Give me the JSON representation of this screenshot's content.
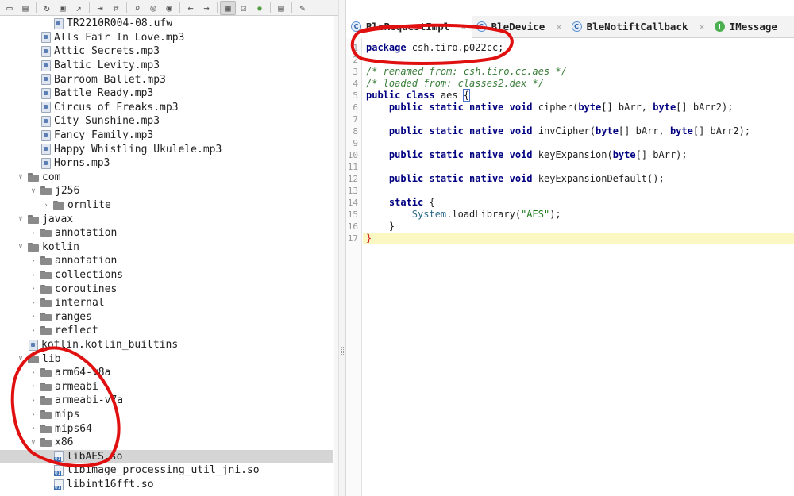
{
  "toolbar": {
    "icons": [
      "folder-open-icon",
      "save-all-icon",
      "refresh-icon",
      "save-icon",
      "export-icon",
      "expand-icon",
      "sync-icon",
      "search-icon",
      "find-class-icon",
      "find-usage-icon",
      "back-icon",
      "forward-icon",
      "flatten-icon",
      "decompile-icon",
      "debug-icon",
      "log-icon",
      "settings-icon"
    ]
  },
  "tree": {
    "rows": [
      {
        "label": "TR2210R004-08.ufw",
        "indent": 4,
        "type": "file"
      },
      {
        "label": "Alls Fair In Love.mp3",
        "indent": 3,
        "type": "file"
      },
      {
        "label": "Attic Secrets.mp3",
        "indent": 3,
        "type": "file"
      },
      {
        "label": "Baltic Levity.mp3",
        "indent": 3,
        "type": "file"
      },
      {
        "label": "Barroom Ballet.mp3",
        "indent": 3,
        "type": "file"
      },
      {
        "label": "Battle Ready.mp3",
        "indent": 3,
        "type": "file"
      },
      {
        "label": "Circus of Freaks.mp3",
        "indent": 3,
        "type": "file"
      },
      {
        "label": "City Sunshine.mp3",
        "indent": 3,
        "type": "file"
      },
      {
        "label": "Fancy Family.mp3",
        "indent": 3,
        "type": "file"
      },
      {
        "label": "Happy Whistling Ukulele.mp3",
        "indent": 3,
        "type": "file"
      },
      {
        "label": "Horns.mp3",
        "indent": 3,
        "type": "file"
      },
      {
        "label": "com",
        "indent": 1,
        "type": "folder",
        "open": true
      },
      {
        "label": "j256",
        "indent": 2,
        "type": "folder",
        "open": true
      },
      {
        "label": "ormlite",
        "indent": 3,
        "type": "folder",
        "open": false
      },
      {
        "label": "javax",
        "indent": 1,
        "type": "folder",
        "open": true
      },
      {
        "label": "annotation",
        "indent": 2,
        "type": "folder",
        "open": false
      },
      {
        "label": "kotlin",
        "indent": 1,
        "type": "folder",
        "open": true
      },
      {
        "label": "annotation",
        "indent": 2,
        "type": "folder",
        "open": false
      },
      {
        "label": "collections",
        "indent": 2,
        "type": "folder",
        "open": false
      },
      {
        "label": "coroutines",
        "indent": 2,
        "type": "folder",
        "open": false
      },
      {
        "label": "internal",
        "indent": 2,
        "type": "folder",
        "open": false
      },
      {
        "label": "ranges",
        "indent": 2,
        "type": "folder",
        "open": false
      },
      {
        "label": "reflect",
        "indent": 2,
        "type": "folder",
        "open": false
      },
      {
        "label": "kotlin.kotlin_builtins",
        "indent": 2,
        "type": "file"
      },
      {
        "label": "lib",
        "indent": 1,
        "type": "folder",
        "open": true
      },
      {
        "label": "arm64-v8a",
        "indent": 2,
        "type": "folder",
        "open": false
      },
      {
        "label": "armeabi",
        "indent": 2,
        "type": "folder",
        "open": false
      },
      {
        "label": "armeabi-v7a",
        "indent": 2,
        "type": "folder",
        "open": false
      },
      {
        "label": "mips",
        "indent": 2,
        "type": "folder",
        "open": false
      },
      {
        "label": "mips64",
        "indent": 2,
        "type": "folder",
        "open": false
      },
      {
        "label": "x86",
        "indent": 2,
        "type": "folder",
        "open": true
      },
      {
        "label": "libAES.so",
        "indent": 4,
        "type": "so",
        "selected": true
      },
      {
        "label": "libimage_processing_util_jni.so",
        "indent": 4,
        "type": "so"
      },
      {
        "label": "libint16fft.so",
        "indent": 4,
        "type": "so"
      }
    ]
  },
  "tabs": [
    {
      "label": "BleRequestImpl",
      "icon": "C",
      "active": true
    },
    {
      "label": "BleDevice",
      "icon": "C"
    },
    {
      "label": "BleNotiftCallback",
      "icon": "C"
    },
    {
      "label": "IMessage",
      "icon": "I"
    }
  ],
  "editor": {
    "lines": [
      {
        "n": "1",
        "html": "<span class='kw'>package</span> csh.tiro.p022cc;"
      },
      {
        "n": "2",
        "html": ""
      },
      {
        "n": "3",
        "html": "<span class='cm'>/* renamed from: csh.tiro.cc.aes */</span>"
      },
      {
        "n": "4",
        "html": "<span class='cm'>/* loaded from: classes2.dex */</span>"
      },
      {
        "n": "5",
        "html": "<span class='kw'>public class</span> aes <span class='brace-box'>{</span>"
      },
      {
        "n": "6",
        "html": "    <span class='kw'>public static native void</span> cipher(<span class='kw'>byte</span>[] bArr, <span class='kw'>byte</span>[] bArr2);"
      },
      {
        "n": "7",
        "html": ""
      },
      {
        "n": "8",
        "html": "    <span class='kw'>public static native void</span> invCipher(<span class='kw'>byte</span>[] bArr, <span class='kw'>byte</span>[] bArr2);"
      },
      {
        "n": "9",
        "html": ""
      },
      {
        "n": "10",
        "html": "    <span class='kw'>public static native void</span> keyExpansion(<span class='kw'>byte</span>[] bArr);"
      },
      {
        "n": "11",
        "html": ""
      },
      {
        "n": "12",
        "html": "    <span class='kw'>public static native void</span> keyExpansionDefault();"
      },
      {
        "n": "13",
        "html": ""
      },
      {
        "n": "14",
        "html": "    <span class='kw'>static</span> {"
      },
      {
        "n": "15",
        "html": "        <span class='cls'>System</span>.loadLibrary(<span class='str'>\"AES\"</span>);"
      },
      {
        "n": "16",
        "html": "    }"
      },
      {
        "n": "17",
        "html": "<span class='brace-red'>}</span>"
      }
    ],
    "highlighted_line": "17"
  }
}
